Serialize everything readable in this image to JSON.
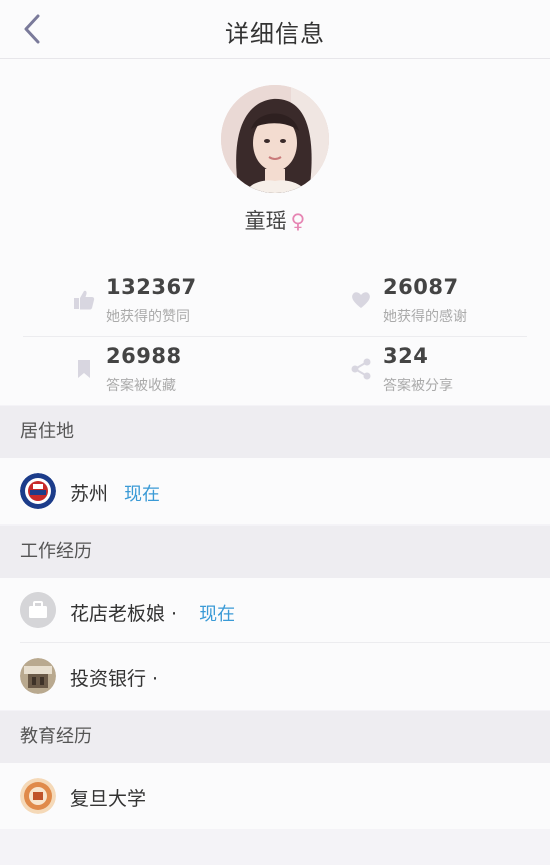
{
  "header": {
    "title": "详细信息",
    "back_icon": "chevron-left-icon"
  },
  "profile": {
    "name": "童瑶",
    "gender_symbol": "♀",
    "stats": [
      {
        "value": "132367",
        "label": "她获得的赞同",
        "icon": "thumbs-up-icon"
      },
      {
        "value": "26087",
        "label": "她获得的感谢",
        "icon": "heart-icon"
      },
      {
        "value": "26988",
        "label": "答案被收藏",
        "icon": "bookmark-icon"
      },
      {
        "value": "324",
        "label": "答案被分享",
        "icon": "share-icon"
      }
    ]
  },
  "residence": {
    "header": "居住地",
    "items": [
      {
        "name": "苏州",
        "status": "现在"
      }
    ]
  },
  "work": {
    "header": "工作经历",
    "items": [
      {
        "name": "花店老板娘 ·",
        "status": "现在"
      },
      {
        "name": "投资银行 ·"
      }
    ]
  },
  "education": {
    "header": "教育经历",
    "items": [
      {
        "name": "复旦大学"
      }
    ]
  },
  "colors": {
    "accent": "#3a9ad6",
    "icon": "#d8d6e0",
    "female": "#e685b3"
  }
}
